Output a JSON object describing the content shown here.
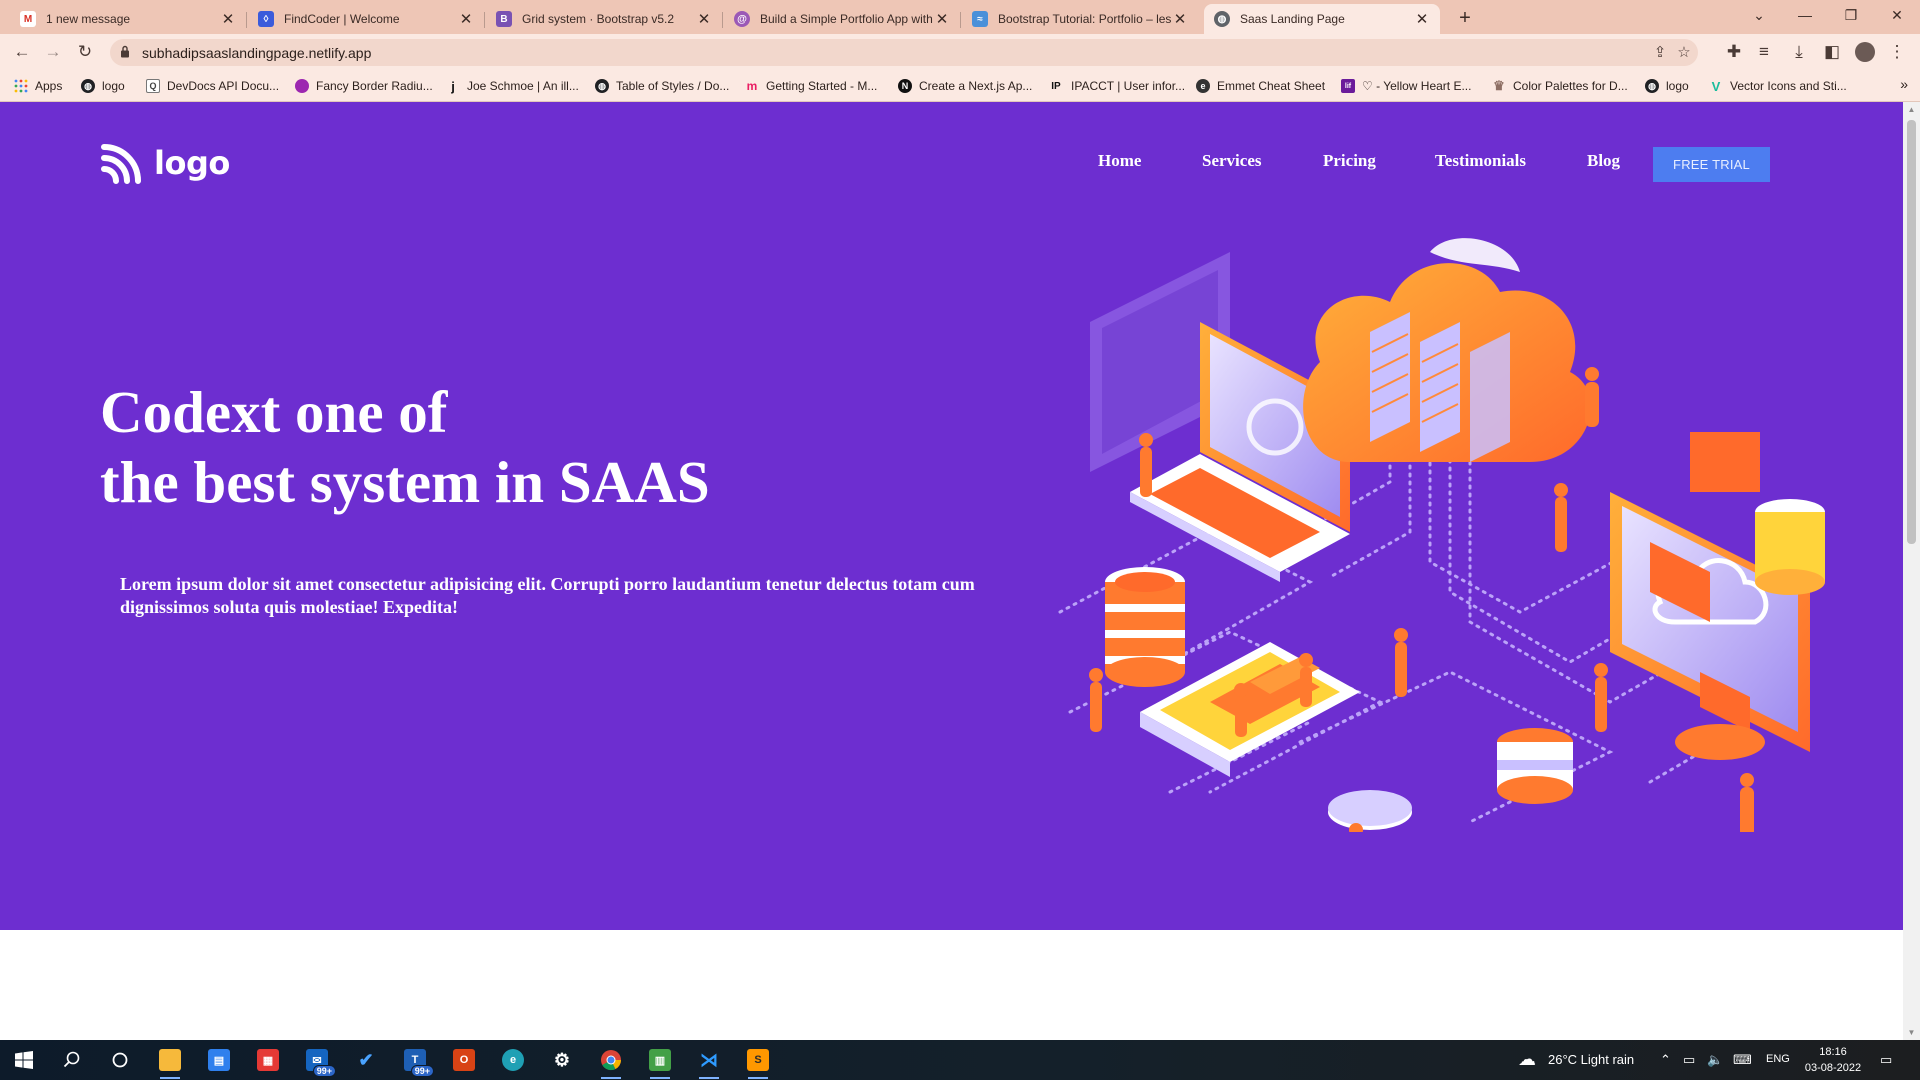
{
  "browser": {
    "tabs": [
      {
        "title": "1 new message",
        "favicon": "gmail-icon",
        "color": "#d93025",
        "glyph": "M"
      },
      {
        "title": "FindCoder | Welcome",
        "favicon": "findcoder-icon",
        "color": "#3b5bdb",
        "glyph": "◊"
      },
      {
        "title": "Grid system · Bootstrap v5.2",
        "favicon": "bootstrap-icon",
        "color": "#7952b3",
        "glyph": "B"
      },
      {
        "title": "Build a Simple Portfolio App with",
        "favicon": "blog-icon",
        "color": "#9b59b6",
        "glyph": "@"
      },
      {
        "title": "Bootstrap Tutorial: Portfolio – les",
        "favicon": "course-icon",
        "color": "#4a90d9",
        "glyph": "≈"
      },
      {
        "title": "Saas Landing Page",
        "favicon": "globe-icon",
        "color": "#5f6368",
        "glyph": "◍"
      }
    ],
    "url": "subhadipsaaslandingpage.netlify.app",
    "bookmarks": [
      {
        "label": "Apps",
        "icon": "apps-grid-icon",
        "color": "#4285f4",
        "glyph": "⋮"
      },
      {
        "label": "logo",
        "icon": "globe-icon",
        "color": "#202124",
        "glyph": "◍"
      },
      {
        "label": "DevDocs API Docu...",
        "icon": "devdocs-icon",
        "color": "#6b6b6b",
        "glyph": "Q"
      },
      {
        "label": "Fancy Border Radiu...",
        "icon": "fancy-border-icon",
        "color": "#9c27b0",
        "glyph": "●"
      },
      {
        "label": "Joe Schmoe | An ill...",
        "icon": "joe-schmoe-icon",
        "color": "#222222",
        "glyph": "j"
      },
      {
        "label": "Table of Styles / Do...",
        "icon": "globe-icon",
        "color": "#202124",
        "glyph": "◍"
      },
      {
        "label": "Getting Started - M...",
        "icon": "mui-icon",
        "color": "#e91e63",
        "glyph": "m"
      },
      {
        "label": "Create a Next.js Ap...",
        "icon": "nextjs-icon",
        "color": "#111111",
        "glyph": "N"
      },
      {
        "label": "IPACCT | User infor...",
        "icon": "ipacct-icon",
        "color": "#1a1a1a",
        "glyph": "IP"
      },
      {
        "label": "Emmet Cheat Sheet",
        "icon": "emmet-icon",
        "color": "#333333",
        "glyph": "e"
      },
      {
        "label": "♡ - Yellow Heart E...",
        "icon": "emojipedia-icon",
        "color": "#6a1b9a",
        "glyph": "lif"
      },
      {
        "label": "Color Palettes for D...",
        "icon": "colorhunt-icon",
        "color": "#8d6e63",
        "glyph": "♛"
      },
      {
        "label": "logo",
        "icon": "globe-icon",
        "color": "#202124",
        "glyph": "◍"
      },
      {
        "label": "Vector Icons and Sti...",
        "icon": "flaticon-icon",
        "color": "#1abc9c",
        "glyph": "V"
      }
    ]
  },
  "page": {
    "logo_text": "logo",
    "nav": [
      "Home",
      "Services",
      "Pricing",
      "Testimonials",
      "Blog"
    ],
    "cta": "FREE TRIAL",
    "headline_line1": "Codext one of",
    "headline_line2": "the best system in SAAS",
    "subtext": "Lorem ipsum dolor sit amet consectetur adipisicing elit. Corrupti porro laudantium tenetur delectus totam cum dignissimos soluta quis molestiae! Expedita!",
    "colors": {
      "hero_bg": "#6d2ed0",
      "cta_bg": "#4d7df0",
      "accent_orange": "#ff7a2f"
    }
  },
  "taskbar": {
    "apps": [
      {
        "name": "start-icon",
        "color": "#1e88e5"
      },
      {
        "name": "search-icon",
        "color": "transparent"
      },
      {
        "name": "cortana-icon",
        "color": "transparent"
      },
      {
        "name": "file-explorer-icon",
        "color": "#f6b93b"
      },
      {
        "name": "store-icon",
        "color": "#2f80ed"
      },
      {
        "name": "gift-app-icon",
        "color": "#e53935"
      },
      {
        "name": "mail-icon",
        "color": "#1565c0",
        "badge": "99+"
      },
      {
        "name": "todo-icon",
        "color": "#1e88e5"
      },
      {
        "name": "teams-icon",
        "color": "#1e5fb4",
        "badge": "99+"
      },
      {
        "name": "office-icon",
        "color": "#d84315"
      },
      {
        "name": "edge-icon",
        "color": "#1fa0b4"
      },
      {
        "name": "settings-icon",
        "color": "transparent"
      },
      {
        "name": "chrome-icon",
        "color": "#f4b400"
      },
      {
        "name": "notepad-icon",
        "color": "#43a047"
      },
      {
        "name": "vscode-icon",
        "color": "#1e88e5"
      },
      {
        "name": "sublime-icon",
        "color": "#ff9800"
      }
    ],
    "weather": "26°C  Light rain",
    "language": "ENG",
    "time": "18:16",
    "date": "03-08-2022"
  }
}
